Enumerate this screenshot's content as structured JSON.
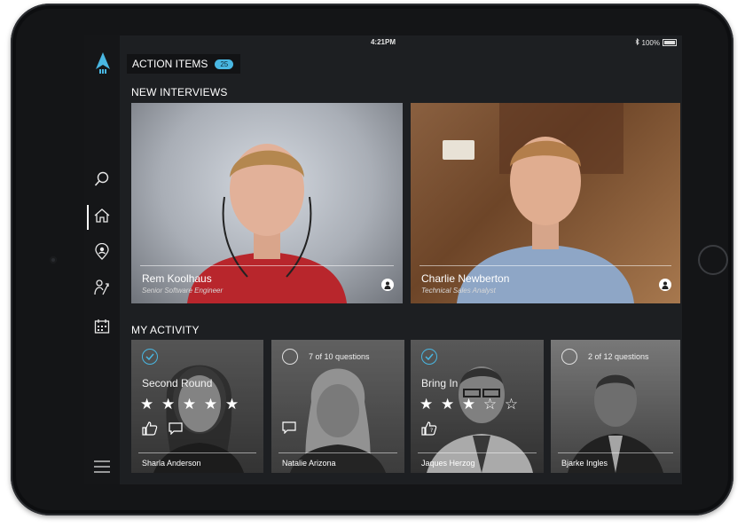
{
  "status_bar": {
    "device": "iPad",
    "time": "4:21PM",
    "battery": "100%"
  },
  "sidebar": {
    "items": [
      {
        "name": "search",
        "icon": "search-icon"
      },
      {
        "name": "home",
        "icon": "home-icon",
        "active": true
      },
      {
        "name": "location",
        "icon": "location-pin-icon"
      },
      {
        "name": "people",
        "icon": "people-icon"
      },
      {
        "name": "calendar",
        "icon": "calendar-icon"
      }
    ],
    "menu_icon": "menu-icon"
  },
  "action_items": {
    "label": "ACTION ITEMS",
    "count": "25"
  },
  "new_interviews": {
    "title": "NEW INTERVIEWS",
    "cards": [
      {
        "name": "Rem Koolhaus",
        "role": "Senior Software Engineer"
      },
      {
        "name": "Charlie Newberton",
        "role": "Technical Sales Analyst"
      }
    ]
  },
  "my_activity": {
    "title": "MY ACTIVITY",
    "cards": [
      {
        "name": "Sharla Anderson",
        "status": "complete",
        "stage": "Second Round",
        "rating": 5,
        "stars": "★ ★ ★ ★ ★"
      },
      {
        "name": "Natalie Arizona",
        "status": "in-progress",
        "progress": "7 of 10 questions",
        "answered": 7,
        "total": 10
      },
      {
        "name": "Jaques Herzog",
        "status": "complete",
        "stage": "Bring In",
        "rating": 3,
        "stars": "★ ★ ★ ☆ ☆"
      },
      {
        "name": "Bjarke Ingles",
        "status": "in-progress",
        "progress": "2 of 12 questions",
        "answered": 2,
        "total": 12
      }
    ]
  },
  "colors": {
    "accent": "#49b7e2",
    "background": "#1d1f22",
    "sidebar": "#151618"
  }
}
